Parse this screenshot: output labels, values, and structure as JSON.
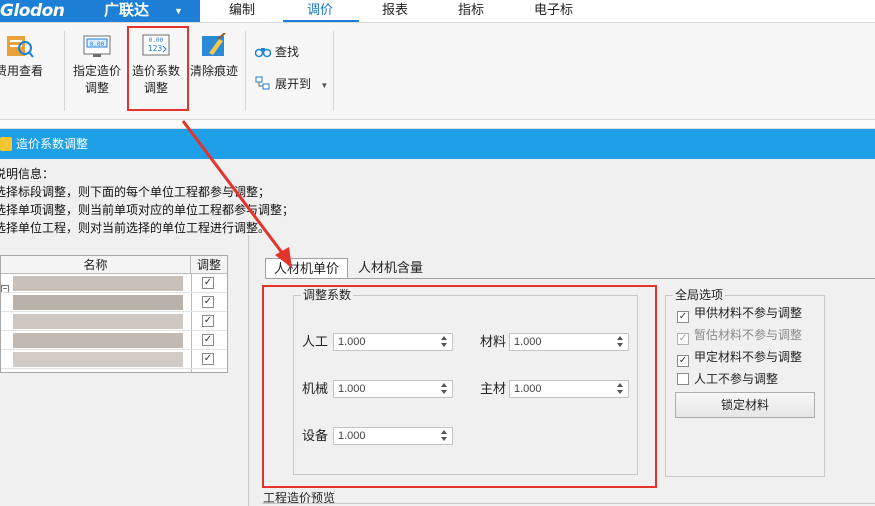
{
  "app": {
    "logo_text": "Glodon",
    "logo_cn": "广联达",
    "logo_dropdown": "▼"
  },
  "menu": [
    "编制",
    "调价",
    "报表",
    "指标",
    "电子标"
  ],
  "ribbon": {
    "fee_view": "费用查看",
    "specify_price_adjust_1": "指定造价",
    "specify_price_adjust_2": "调整",
    "coef_adjust_1": "造价系数",
    "coef_adjust_2": "调整",
    "clear_marks": "清除痕迹",
    "find": "查找",
    "expand_to": "展开到",
    "coef_icon_top": "0.00",
    "coef_icon_bottom": "123"
  },
  "dialog": {
    "title": "造价系数调整",
    "info_lines": [
      "说明信息：",
      "选择标段调整，则下面的每个单位工程都参与调整；",
      "选择单项调整，则当前单项对应的单位工程都参与调整；",
      "选择单位工程，则对当前选择的单位工程进行调整。"
    ],
    "grid": {
      "col_name": "名称",
      "col_adjust": "调整",
      "rows_checked": [
        true,
        true,
        true,
        true,
        true
      ]
    },
    "tabs": [
      "人材机单价",
      "人材机含量"
    ],
    "coef_group_label": "调整系数",
    "fields": {
      "labor": {
        "label": "人工",
        "value": "1.000"
      },
      "material": {
        "label": "材料",
        "value": "1.000"
      },
      "machine": {
        "label": "机械",
        "value": "1.000"
      },
      "main_material": {
        "label": "主材",
        "value": "1.000"
      },
      "equipment": {
        "label": "设备",
        "value": "1.000"
      }
    },
    "global_options": {
      "label": "全局选项",
      "items": [
        {
          "label": "甲供材料不参与调整",
          "checked": true,
          "enabled": true
        },
        {
          "label": "暂估材料不参与调整",
          "checked": true,
          "enabled": false
        },
        {
          "label": "甲定材料不参与调整",
          "checked": true,
          "enabled": true
        },
        {
          "label": "人工不参与调整",
          "checked": false,
          "enabled": true
        }
      ],
      "lock_button": "锁定材料"
    },
    "preview_label": "工程造价预览"
  },
  "colors": {
    "accent": "#1e7fd6",
    "title_bar": "#1e9fe6",
    "highlight_red": "#e2342b"
  }
}
